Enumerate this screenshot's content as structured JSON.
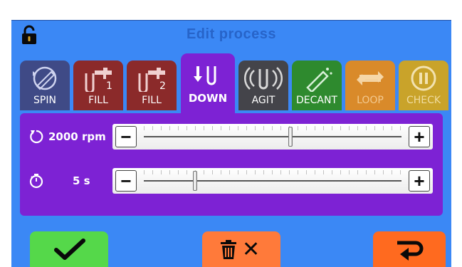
{
  "app": {
    "title": "Edit process",
    "lock_icon": "lock-icon",
    "colors": {
      "screen": "#3b88f5",
      "title_text": "#2764c9",
      "panel": "#7d22d4",
      "confirm": "#55d84a",
      "delete": "#ff7a3a",
      "back": "#ff6a1f"
    }
  },
  "tabs": [
    {
      "label": "SPIN",
      "icon": "spin-icon",
      "color": "#3f4a86",
      "active": false
    },
    {
      "label": "FILL",
      "badge": "1",
      "icon": "fill-tap-icon",
      "color": "#8b2a2a",
      "active": false
    },
    {
      "label": "FILL",
      "badge": "2",
      "icon": "fill-tap-icon",
      "color": "#8b2a2a",
      "active": false
    },
    {
      "label": "DOWN",
      "icon": "down-arrows-icon",
      "color": "#7d22d4",
      "active": true
    },
    {
      "label": "AGIT",
      "icon": "agitate-icon",
      "color": "#44444a",
      "active": false
    },
    {
      "label": "DECANT",
      "icon": "decant-icon",
      "color": "#2e8a2e",
      "active": false
    },
    {
      "label": "LOOP",
      "icon": "loop-icon",
      "color": "#d98a2a",
      "active": false
    },
    {
      "label": "CHECK",
      "icon": "pause-check-icon",
      "color": "#c9a32a",
      "active": false
    }
  ],
  "speed": {
    "value_text": "2000 rpm",
    "icon": "rotate-icon",
    "level": 0.57
  },
  "time": {
    "value_text": "5 s",
    "icon": "timer-icon",
    "level": 0.2
  },
  "buttons": {
    "minus": "−",
    "plus": "+",
    "confirm_icon": "checkmark-icon",
    "delete_icon": "trash-icon",
    "delete_mark": "✕",
    "back_icon": "return-arrow-icon"
  }
}
